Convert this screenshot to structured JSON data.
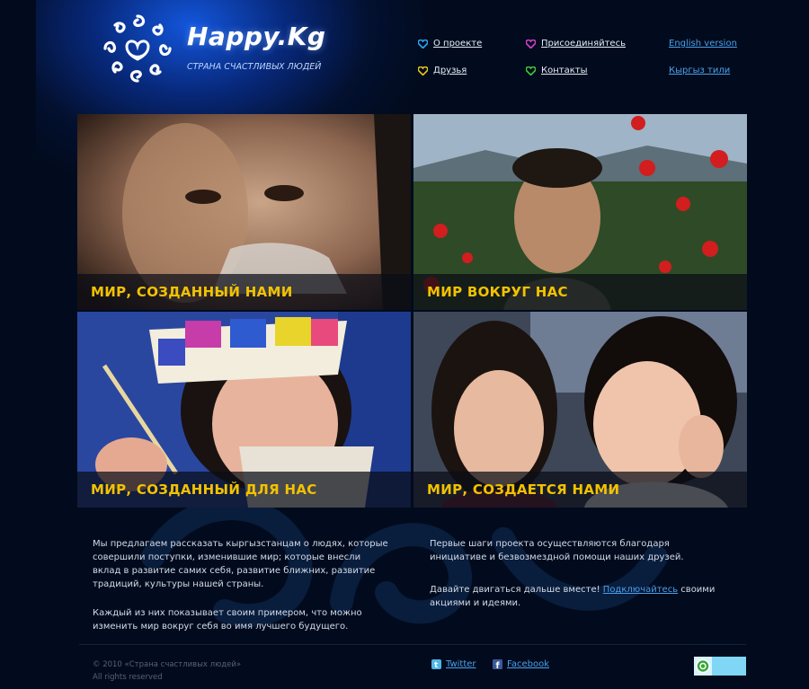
{
  "brand": {
    "name": "Happy.Kg",
    "tagline": "СТРАНА СЧАСТЛИВЫХ ЛЮДЕЙ"
  },
  "nav": {
    "items": [
      {
        "label": "О проекте",
        "heart_color": "#2aa6f5"
      },
      {
        "label": "Присоединяйтесь",
        "heart_color": "#d83fd0"
      },
      {
        "label": "Друзья",
        "heart_color": "#e8c51a"
      },
      {
        "label": "Контакты",
        "heart_color": "#3ccb3a"
      }
    ],
    "languages": [
      "English version",
      "Кыргыз тили"
    ]
  },
  "tiles": [
    {
      "caption": "МИР, СОЗДАННЫЙ НАМИ"
    },
    {
      "caption": "МИР ВОКРУГ НАС"
    },
    {
      "caption": "МИР, СОЗДАННЫЙ ДЛЯ НАС"
    },
    {
      "caption": "МИР, СОЗДАЕТСЯ НАМИ"
    }
  ],
  "content": {
    "left_p1": "Мы предлагаем рассказать кыргызстанцам о людях, которые совершили поступки, изменившие мир; которые внесли вклад в развитие самих себя, развитие ближних, развитие традиций, культуры нашей страны.",
    "left_p2": "Каждый из них показывает своим примером, что можно изменить мир вокруг себя во имя лучшего будущего.",
    "right_p1": "Первые шаги проекта осуществляются благодаря инициативе и безвозмездной помощи наших друзей.",
    "right_p2_before": "Давайте двигаться дальше вместе!",
    "right_p2_link": "Подключайтесь",
    "right_p2_after": "своими акциями и идеями."
  },
  "footer": {
    "copyright": "© 2010 «Страна счастливых людей»",
    "rights": "All rights reserved",
    "twitter": "Twitter",
    "facebook": "Facebook"
  },
  "colors": {
    "caption": "#f2c200",
    "link": "#4aa0ee",
    "background": "#020b1d"
  }
}
